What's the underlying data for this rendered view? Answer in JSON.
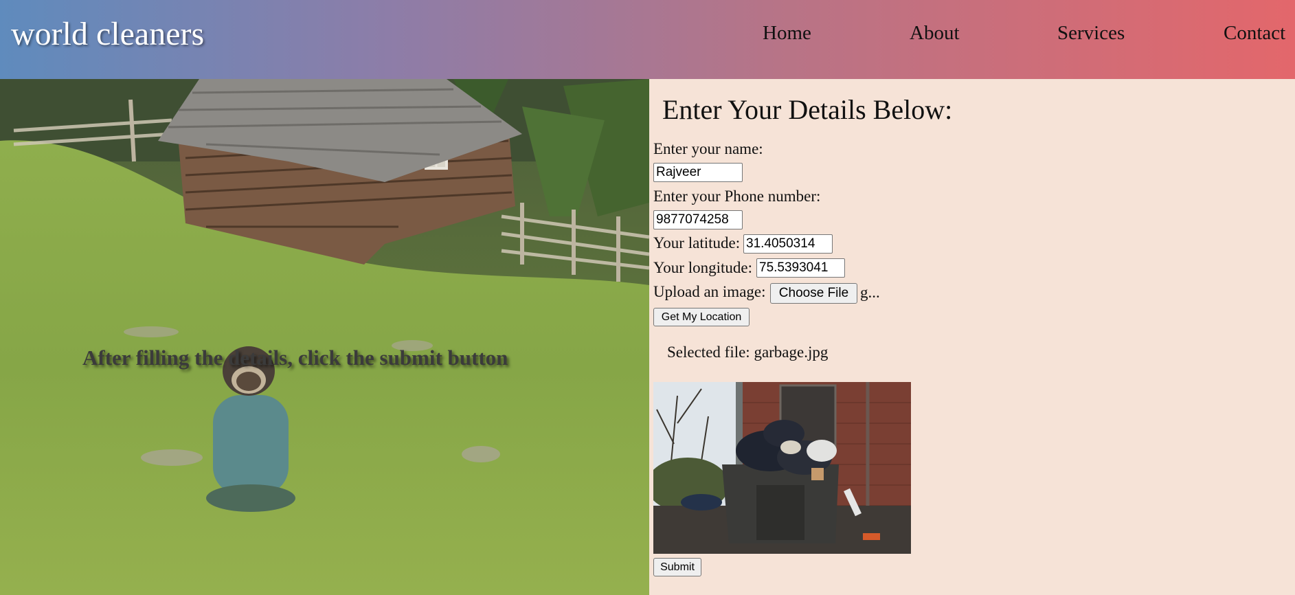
{
  "header": {
    "brand": "world cleaners",
    "nav": [
      {
        "label": "Home"
      },
      {
        "label": "About"
      },
      {
        "label": "Services"
      },
      {
        "label": "Contact"
      }
    ]
  },
  "hero": {
    "caption": "After filling the details, click the submit button"
  },
  "form": {
    "title": "Enter Your Details Below:",
    "name_label": "Enter your name:",
    "name_value": "Rajveer",
    "phone_label": "Enter your Phone number:",
    "phone_value": "9877074258",
    "latitude_label": "Your latitude:",
    "latitude_value": "31.4050314",
    "longitude_label": "Your longitude:",
    "longitude_value": "75.5393041",
    "upload_label": "Upload an image:",
    "choose_file_label": "Choose File",
    "chosen_file_truncated": "g...",
    "location_button": "Get My Location",
    "selected_file_text": "Selected file: garbage.jpg",
    "submit_button": "Submit"
  },
  "colors": {
    "header_gradient": [
      "#5f8bbd",
      "#8d7da8",
      "#b77487",
      "#e3676b"
    ],
    "form_background": "#f6e3d7"
  }
}
